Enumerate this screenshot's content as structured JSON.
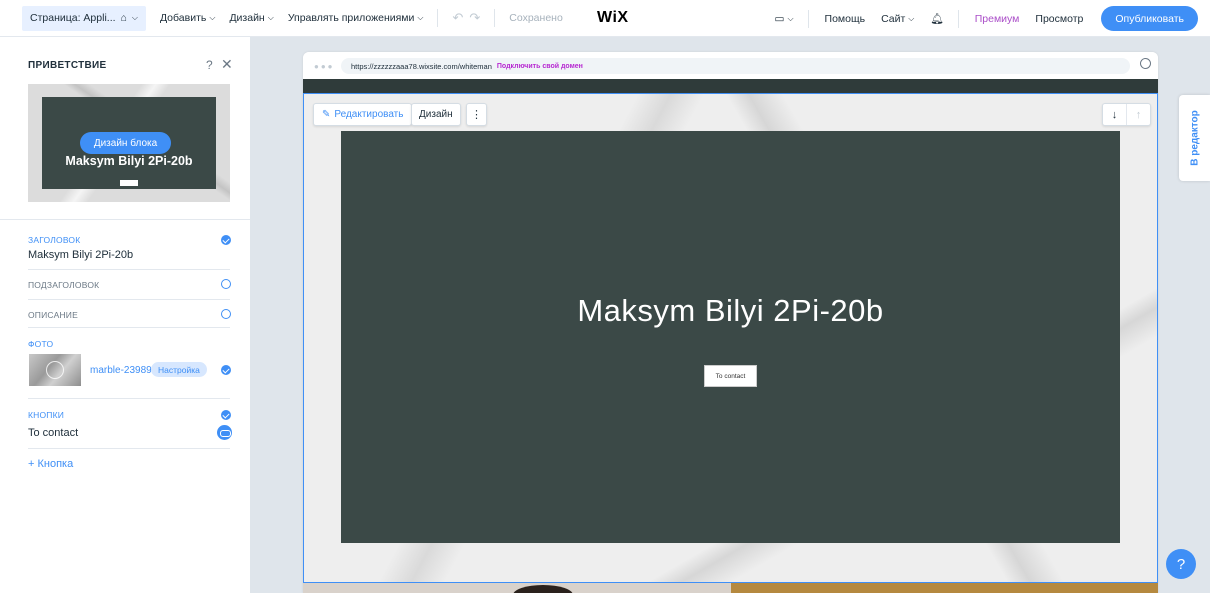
{
  "topbar": {
    "page": "Страница: Appli...",
    "add": "Добавить",
    "design": "Дизайн",
    "apps": "Управлять приложениями",
    "saved": "Сохранено",
    "logo": "WiX",
    "help": "Помощь",
    "site": "Сайт",
    "premium": "Премиум",
    "preview": "Просмотр",
    "publish": "Опубликовать"
  },
  "panel": {
    "title": "ПРИВЕТСТВИЕ",
    "help": "?",
    "close": "✕",
    "preview_button": "Дизайн блока",
    "preview_title": "Maksym Bilyi 2Pi-20b",
    "heading_label": "ЗАГОЛОВОК",
    "heading_value": "Maksym Bilyi 2Pi-20b",
    "subheading_label": "ПОДЗАГОЛОВОК",
    "description_label": "ОПИСАНИЕ",
    "photo_label": "ФОТО",
    "photo_file": "marble-23989...",
    "photo_tune": "Настройка",
    "buttons_label": "КНОПКИ",
    "button_value": "To contact",
    "add_button": "+ Кнопка"
  },
  "canvas": {
    "url": "https://zzzzzzaaa78.wixsite.com/whiteman",
    "connect_domain": "Подключить свой домен",
    "edit": "Редактировать",
    "design": "Дизайн",
    "more": "⋮",
    "down": "↓",
    "up": "↑",
    "hero_title": "Maksym Bilyi 2Pi-20b",
    "hero_button": "To contact"
  },
  "side_tab": "В редактор",
  "help_fab": "?"
}
